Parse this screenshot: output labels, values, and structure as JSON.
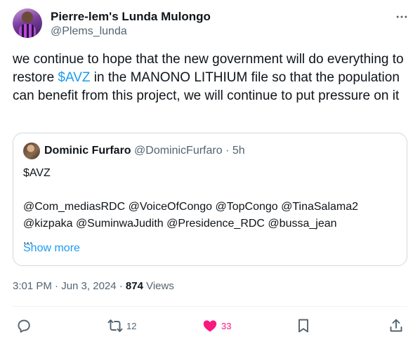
{
  "author": {
    "name": "Pierre-lem's Lunda Mulongo",
    "handle": "@Plems_lunda"
  },
  "tweet": {
    "text_before": "we continue to hope that the new government will do everything to restore ",
    "cashtag": "$AVZ",
    "text_after": " in the MANONO LITHIUM file so that the population can benefit from this project, we will continue to put pressure on it"
  },
  "quote": {
    "name": "Dominic Furfaro",
    "handle_time": "@DominicFurfaro · 5h",
    "body": "$AVZ\n\n@Com_mediasRDC @VoiceOfCongo @TopCongo @TinaSalama2\n@kizpaka @SuminwaJudith @Presidence_RDC @bussa_jean\n...",
    "show_more": "Show more"
  },
  "meta": {
    "timestamp": "3:01 PM · Jun 3, 2024 · ",
    "views_count": "874",
    "views_label": " Views"
  },
  "actions": {
    "retweets": "12",
    "likes": "33"
  },
  "colors": {
    "accent": "#1d9bf0",
    "like": "#f91880",
    "muted": "#536471"
  },
  "icons": [
    "more-icon",
    "reply-icon",
    "retweet-icon",
    "heart-icon",
    "bookmark-icon",
    "share-icon"
  ]
}
